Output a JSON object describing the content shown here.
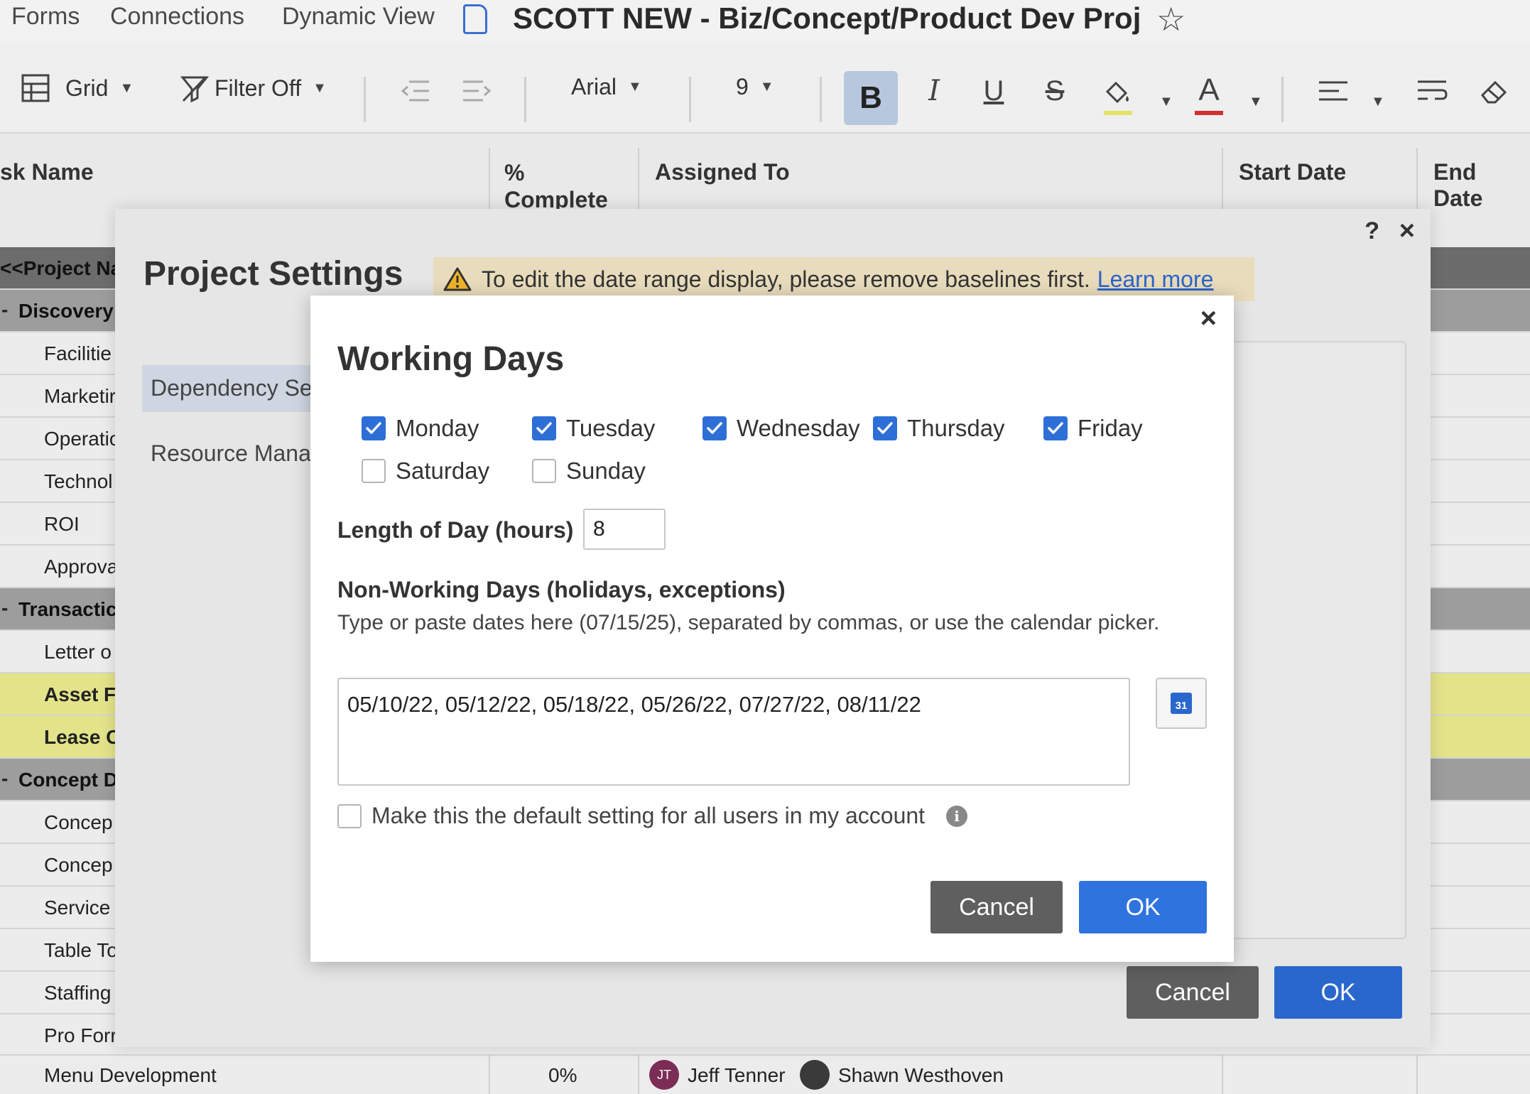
{
  "topnav": {
    "links": [
      "Forms",
      "Connections",
      "Dynamic View"
    ],
    "sheet_title": "SCOTT NEW - Biz/Concept/Product Dev Proj"
  },
  "toolbar": {
    "view": "Grid",
    "filter": "Filter Off",
    "font": "Arial",
    "font_size": "9",
    "bold": "B",
    "italic": "I",
    "underline": "U",
    "strike": "S",
    "fill_color": "#e3e36a",
    "text_color": "#d32f2f"
  },
  "grid": {
    "columns": [
      "sk Name",
      "%\nComplete",
      "Assigned To",
      "Start Date",
      "End Date"
    ],
    "rows": [
      {
        "name": "<<Project Na",
        "type": "project"
      },
      {
        "name": "Discovery",
        "type": "group"
      },
      {
        "name": "Facilitie",
        "type": "task"
      },
      {
        "name": "Marketir",
        "type": "task"
      },
      {
        "name": "Operatic",
        "type": "task"
      },
      {
        "name": "Technol",
        "type": "task"
      },
      {
        "name": "ROI",
        "type": "task"
      },
      {
        "name": "Approva",
        "type": "task"
      },
      {
        "name": "Transactic",
        "type": "group"
      },
      {
        "name": "Letter o",
        "type": "task"
      },
      {
        "name": "Asset F",
        "type": "highlight"
      },
      {
        "name": "Lease C",
        "type": "highlight"
      },
      {
        "name": "Concept D",
        "type": "group"
      },
      {
        "name": "Concep",
        "type": "task"
      },
      {
        "name": "Concep",
        "type": "task"
      },
      {
        "name": "Service",
        "type": "task"
      },
      {
        "name": "Table To",
        "type": "task"
      },
      {
        "name": "Staffing",
        "type": "task"
      },
      {
        "name": "Pro Forr",
        "type": "task"
      }
    ],
    "last_row": {
      "name": "Menu Development",
      "complete": "0%",
      "assignees": [
        {
          "initials": "JT",
          "name": "Jeff Tenner"
        },
        {
          "initials": "",
          "name": "Shawn Westhoven"
        }
      ]
    }
  },
  "project_settings": {
    "title": "Project Settings",
    "help": "?",
    "close": "×",
    "warning": "To edit the date range display, please remove baselines first.",
    "learn_more": "Learn more",
    "nav": [
      "Dependency Se",
      "Resource Mana"
    ],
    "cancel": "Cancel",
    "ok": "OK"
  },
  "working_days": {
    "title": "Working Days",
    "close": "×",
    "days": [
      {
        "label": "Monday",
        "checked": true
      },
      {
        "label": "Tuesday",
        "checked": true
      },
      {
        "label": "Wednesday",
        "checked": true
      },
      {
        "label": "Thursday",
        "checked": true
      },
      {
        "label": "Friday",
        "checked": true
      },
      {
        "label": "Saturday",
        "checked": false
      },
      {
        "label": "Sunday",
        "checked": false
      }
    ],
    "length_label": "Length of Day (hours)",
    "length_value": "8",
    "nonworking_label": "Non-Working Days (holidays, exceptions)",
    "nonworking_help": "Type or paste dates here (07/15/25), separated by commas, or use the calendar picker.",
    "nonworking_value": "05/10/22, 05/12/22, 05/18/22, 05/26/22, 07/27/22, 08/11/22",
    "calendar_day": "31",
    "default_label": "Make this the default setting for all users in my account",
    "cancel": "Cancel",
    "ok": "OK"
  }
}
